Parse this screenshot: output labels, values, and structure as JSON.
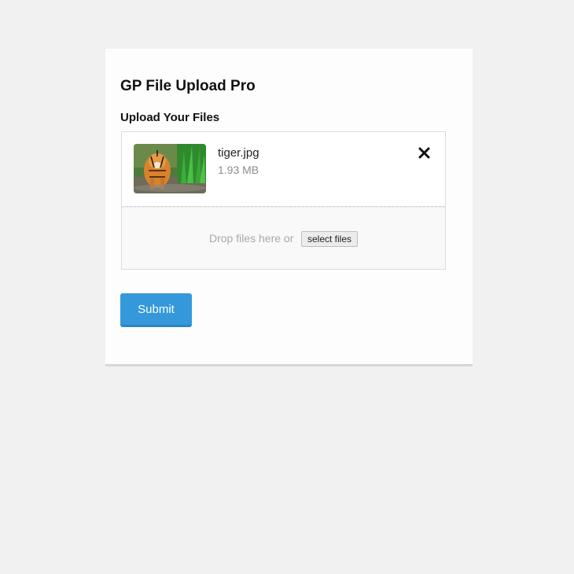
{
  "form": {
    "title": "GP File Upload Pro",
    "field_label": "Upload Your Files",
    "submit_label": "Submit"
  },
  "uploader": {
    "files": [
      {
        "name": "tiger.jpg",
        "size": "1.93 MB",
        "thumbnail": "tiger-photo"
      }
    ],
    "remove_icon": "close-icon",
    "drop_text": "Drop files here or",
    "select_label": "select files"
  },
  "colors": {
    "page_background": "#f1f1f2",
    "card_background": "#fdfdfd",
    "accent": "#3498db",
    "muted_text": "#8d8d8d"
  }
}
